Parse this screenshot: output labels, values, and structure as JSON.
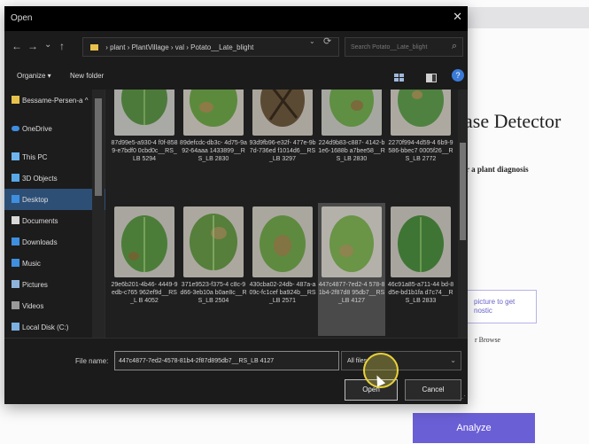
{
  "background_page": {
    "heading": "ase Detector",
    "subtext": "r a plant diagnosis",
    "upload_hint": "picture to get nostic",
    "browse_text": "r Browse",
    "analyze_button": "Analyze"
  },
  "dialog": {
    "title": "Open",
    "close_glyph": "✕",
    "nav": {
      "back": "←",
      "forward": "→",
      "recent": "⌄",
      "up": "↑",
      "refresh": "⟳"
    },
    "address_path": "›  plant  ›  PlantVillage  ›  val  ›  Potato__Late_blight",
    "search_placeholder": "Search Potato__Late_blight",
    "toolbar": {
      "organize": "Organize ▾",
      "new_folder": "New folder"
    },
    "sidebar": [
      {
        "label": "Bessame-Persen-a ^",
        "icon": "folder-icon"
      },
      {
        "label": "OneDrive",
        "icon": "cloud-icon"
      },
      {
        "label": "This PC",
        "icon": "computer-icon"
      },
      {
        "label": "3D Objects",
        "icon": "cube-icon"
      },
      {
        "label": "Desktop",
        "icon": "desktop-icon",
        "selected": true
      },
      {
        "label": "Documents",
        "icon": "document-icon"
      },
      {
        "label": "Downloads",
        "icon": "download-icon"
      },
      {
        "label": "Music",
        "icon": "music-icon"
      },
      {
        "label": "Pictures",
        "icon": "picture-icon"
      },
      {
        "label": "Videos",
        "icon": "video-icon"
      },
      {
        "label": "Local Disk (C:)",
        "icon": "disk-icon"
      }
    ],
    "files": [
      {
        "caption": "87d99e5-a930-4 f0f-8589-e7bdf0 0cbd0c__RS_LB 5294",
        "selected": false
      },
      {
        "caption": "89defcdc-db3c- 4d75-9a92-64aaa 1433899__RS_LB 2830",
        "selected": false
      },
      {
        "caption": "93d9fb96-e32f- 477e-9b7d-736ed f1014d6__RS_LB 3297",
        "selected": false
      },
      {
        "caption": "224d9b83-c887- 4142-b1e6-1688b a7bee58__RS_LB 2830",
        "selected": false
      },
      {
        "caption": "2270f994-4d59-4 6b9-9586-bbec7 0005f26__RS_LB 2772",
        "selected": false
      },
      {
        "caption": "29e6b201-4b46- 4449-9edb-c765 962ef9d__RS_L B 4052",
        "selected": false
      },
      {
        "caption": "371e9523-f375-4 c8c-9d66-3eb10a b0ae8c__RS_LB 2504",
        "selected": false
      },
      {
        "caption": "430cba02-24db- 487a-a09c-fc1cef ba924b__RS_LB 2571",
        "selected": false
      },
      {
        "caption": "447c4877-7ed2-4 578-81b4-2f87d8 95db7__RS_LB 4127",
        "selected": true
      },
      {
        "caption": "46c91a85-a711-44 bd-8d5e-bd1b1fa d7c74__RS_LB 2833",
        "selected": false
      }
    ],
    "filename_label": "File name:",
    "filename_value": "447c4877-7ed2-4578-81b4-2f87d895db7__RS_LB 4127",
    "filter_value": "All files",
    "open_button": "Open",
    "cancel_button": "Cancel"
  }
}
